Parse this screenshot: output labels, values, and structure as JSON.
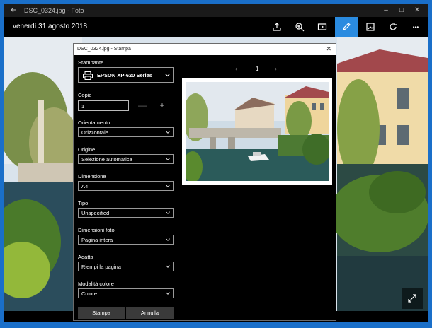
{
  "window": {
    "title": "DSC_0324.jpg - Foto",
    "controls": [
      "–",
      "□",
      "✕"
    ]
  },
  "toolbar": {
    "date": "venerdì 31 agosto 2018",
    "buttons": [
      "share-icon",
      "zoom-icon",
      "slideshow-icon",
      "edit-icon",
      "crop-icon",
      "rotate-icon",
      "more-icon"
    ],
    "more_label": "•••",
    "accent": "#2a8be0"
  },
  "dialog": {
    "title": "DSC_0324.jpg - Stampa",
    "close_label": "✕",
    "printer_label": "Stampante",
    "printer_value": "EPSON XP-620 Series",
    "copies_label": "Copie",
    "copies_value": "1",
    "minus_label": "—",
    "plus_label": "+",
    "orientation_label": "Orientamento",
    "orientation_value": "Orizzontale",
    "source_label": "Origine",
    "source_value": "Selezione automatica",
    "size_label": "Dimensione",
    "size_value": "A4",
    "type_label": "Tipo",
    "type_value": "Unspecified",
    "photo_size_label": "Dimensioni foto",
    "photo_size_value": "Pagina intera",
    "fit_label": "Adatta",
    "fit_value": "Riempi la pagina",
    "color_label": "Modalità colore",
    "color_value": "Colore",
    "page_prev": "‹",
    "page_number": "1",
    "page_next": "›",
    "print_button": "Stampa",
    "cancel_button": "Annulla"
  }
}
